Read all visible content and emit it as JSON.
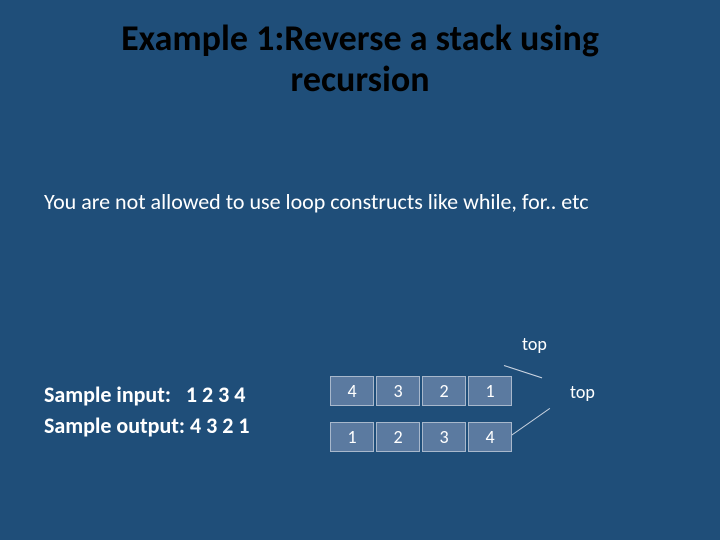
{
  "title": "Example 1:Reverse a stack using recursion",
  "constraint": "You are not allowed to use loop constructs like while, for.. etc",
  "sample": {
    "input_label": "Sample input:   ",
    "input_value": "1 2 3 4",
    "output_label": "Sample output: ",
    "output_value": "4 3 2 1"
  },
  "stacks": {
    "row1": [
      "4",
      "3",
      "2",
      "1"
    ],
    "row2": [
      "1",
      "2",
      "3",
      "4"
    ]
  },
  "top_label": "top"
}
